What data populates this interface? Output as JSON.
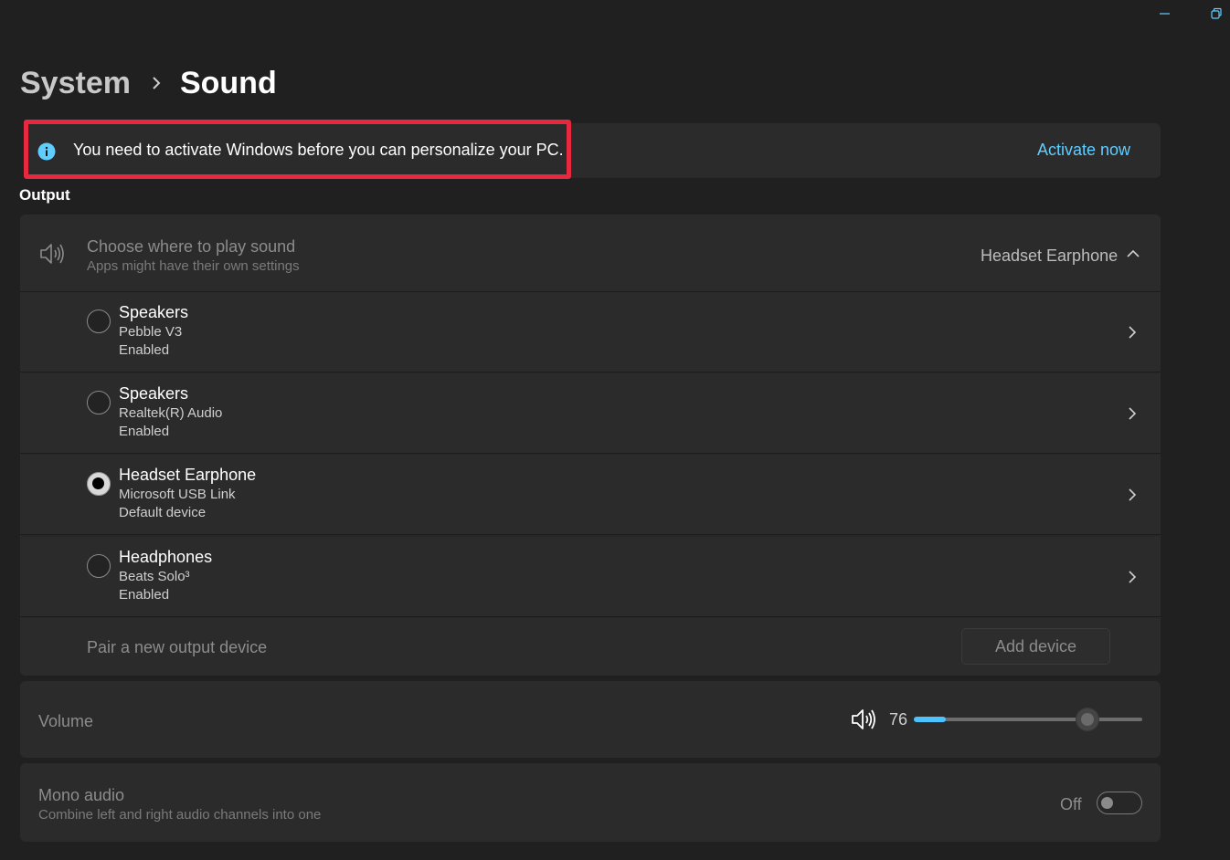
{
  "breadcrumb": {
    "parent": "System",
    "current": "Sound"
  },
  "banner": {
    "message": "You need to activate Windows before you can personalize your PC.",
    "action": "Activate now",
    "icon": "info-icon"
  },
  "output": {
    "section_label": "Output",
    "choose": {
      "title": "Choose where to play sound",
      "subtitle": "Apps might have their own settings",
      "selected": "Headset Earphone",
      "icon": "speaker-icon"
    },
    "devices": [
      {
        "name": "Speakers",
        "model": "Pebble V3",
        "status": "Enabled",
        "checked": false
      },
      {
        "name": "Speakers",
        "model": "Realtek(R) Audio",
        "status": "Enabled",
        "checked": false
      },
      {
        "name": "Headset Earphone",
        "model": "Microsoft USB Link",
        "status": "Default device",
        "checked": true
      },
      {
        "name": "Headphones",
        "model": "Beats Solo³",
        "status": "Enabled",
        "checked": false
      }
    ],
    "pair": {
      "label": "Pair a new output device",
      "button": "Add device"
    }
  },
  "volume": {
    "label": "Volume",
    "value": "76",
    "level": 76,
    "accent": "#4cc2ff"
  },
  "mono": {
    "title": "Mono audio",
    "subtitle": "Combine left and right audio channels into one",
    "state": "Off"
  }
}
